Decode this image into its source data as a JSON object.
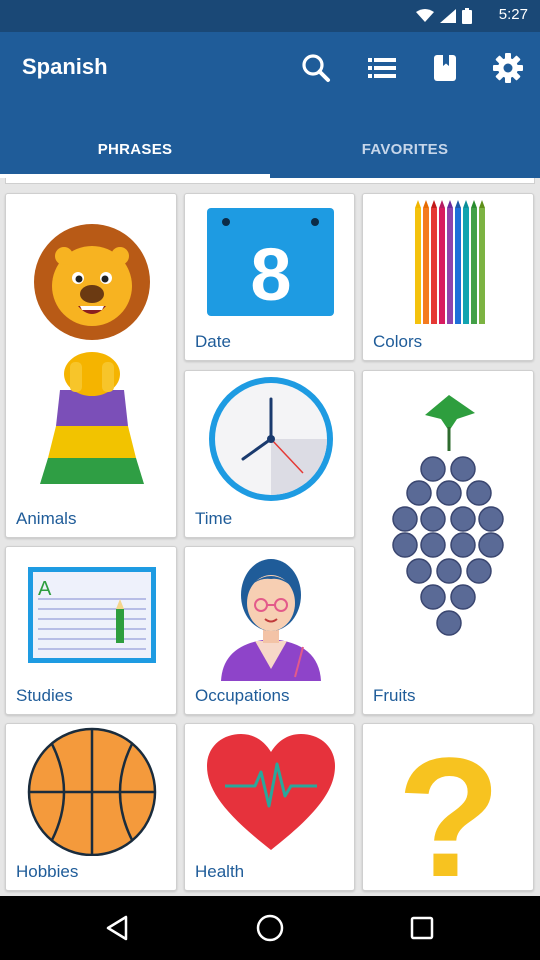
{
  "status_bar": {
    "time": "5:27"
  },
  "app_bar": {
    "title": "Spanish",
    "actions": [
      {
        "name": "search-icon"
      },
      {
        "name": "list-icon"
      },
      {
        "name": "bookmark-icon"
      },
      {
        "name": "settings-icon"
      }
    ]
  },
  "tabs": [
    {
      "label": "PHRASES",
      "active": true
    },
    {
      "label": "FAVORITES",
      "active": false
    }
  ],
  "categories": [
    {
      "label": "Animals",
      "icon": "lion-icon"
    },
    {
      "label": "Date",
      "icon": "calendar-icon",
      "calendar_number": "8"
    },
    {
      "label": "Colors",
      "icon": "colored-pencils-icon"
    },
    {
      "label": "Time",
      "icon": "clock-icon"
    },
    {
      "label": "Fruits",
      "icon": "grapes-icon"
    },
    {
      "label": "Studies",
      "icon": "notebook-icon",
      "notebook_letter": "A"
    },
    {
      "label": "Occupations",
      "icon": "woman-icon"
    },
    {
      "label": "Hobbies",
      "icon": "basketball-icon"
    },
    {
      "label": "Health",
      "icon": "heart-icon"
    },
    {
      "label": "",
      "icon": "question-mark-icon",
      "glyph": "?"
    }
  ],
  "colors": {
    "status_bar": "#1a4876",
    "app_bar": "#1f5c99",
    "label": "#1f5c99",
    "background": "#e6e6e6"
  },
  "nav_bar": [
    {
      "name": "back-button"
    },
    {
      "name": "home-button"
    },
    {
      "name": "recents-button"
    }
  ]
}
